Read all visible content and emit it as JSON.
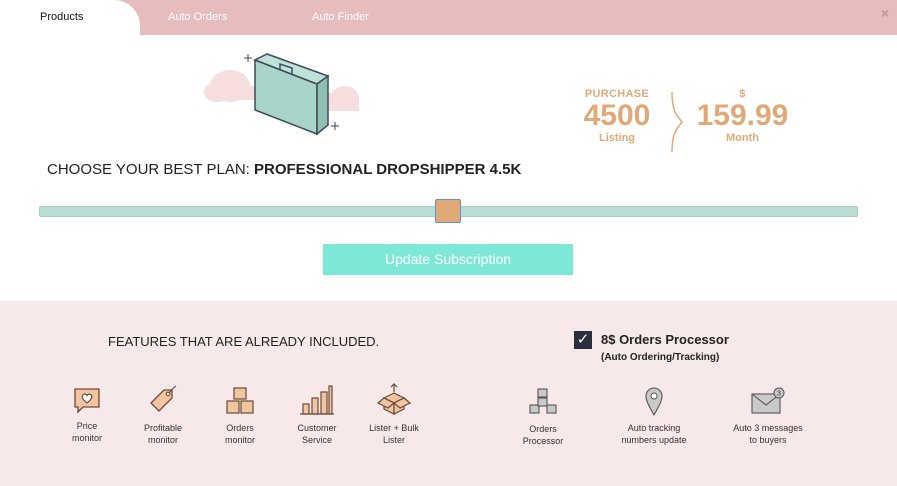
{
  "tabs": [
    {
      "label": "Products",
      "active": true
    },
    {
      "label": "Auto Orders",
      "active": false
    },
    {
      "label": "Auto Finder",
      "active": false
    }
  ],
  "close_label": "×",
  "summary": {
    "left_top": "PURCHASE",
    "left_value": "4500",
    "left_bottom": "Listing",
    "right_top": "$",
    "right_value": "159.99",
    "right_bottom": "Month"
  },
  "plan": {
    "prefix": "CHOOSE YOUR BEST PLAN: ",
    "name": "PROFESSIONAL DROPSHIPPER 4.5K",
    "slider_fraction": 0.5
  },
  "update_button": "Update Subscription",
  "features": {
    "title": "FEATURES THAT ARE ALREADY INCLUDED.",
    "items": [
      {
        "line1": "Price",
        "line2": "monitor",
        "icon": "heart-message-icon"
      },
      {
        "line1": "Profitable",
        "line2": "monitor",
        "icon": "tag-icon"
      },
      {
        "line1": "Orders",
        "line2": "monitor",
        "icon": "boxes-icon"
      },
      {
        "line1": "Customer",
        "line2": "Service",
        "icon": "bar-chart-icon"
      },
      {
        "line1": "Lister + Bulk",
        "line2": "Lister",
        "icon": "open-box-icon"
      }
    ],
    "option": {
      "checked": true,
      "label": "8$ Orders Processor",
      "sublabel": "(Auto Ordering/Tracking)",
      "items": [
        {
          "line1": "Orders",
          "line2": "Processor",
          "icon": "network-boxes-icon"
        },
        {
          "line1": "Auto tracking",
          "line2": "numbers update",
          "icon": "location-pin-icon"
        },
        {
          "line1": "Auto 3 messages",
          "line2": "to buyers",
          "icon": "envelope-icon"
        }
      ]
    }
  },
  "colors": {
    "tab_bar": "#e6bcbc",
    "accent": "#e1a977",
    "slider_track": "#b8ddd2",
    "button": "#7ee8d6",
    "features_bg": "#f7e9e9"
  }
}
